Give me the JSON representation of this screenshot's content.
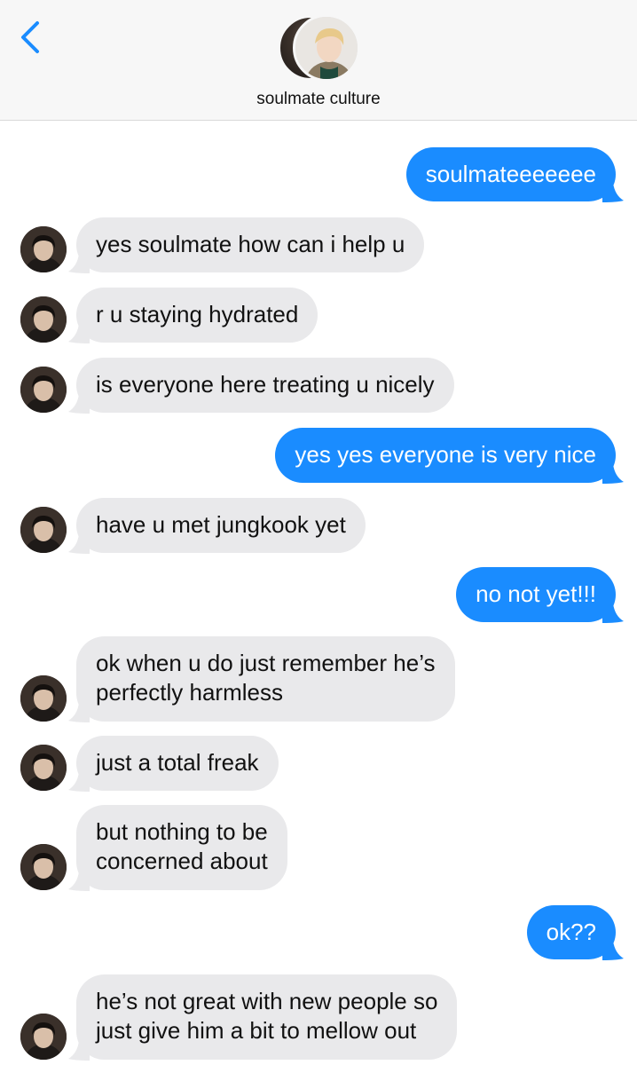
{
  "header": {
    "back_icon": "chevron-left-icon",
    "contact_name": "soulmate culture",
    "accent": "#1a8cff"
  },
  "messages": [
    {
      "dir": "out",
      "lines": [
        "soulmateeeeeee"
      ]
    },
    {
      "dir": "in",
      "lines": [
        "yes soulmate how can i help u"
      ]
    },
    {
      "dir": "in",
      "lines": [
        "r u staying hydrated"
      ]
    },
    {
      "dir": "in",
      "lines": [
        "is everyone here treating u nicely"
      ]
    },
    {
      "dir": "out",
      "lines": [
        "yes yes everyone is very nice"
      ]
    },
    {
      "dir": "in",
      "lines": [
        "have u met jungkook yet"
      ]
    },
    {
      "dir": "out",
      "lines": [
        "no not yet!!!"
      ]
    },
    {
      "dir": "in",
      "lines": [
        "ok when u do just remember he’s",
        "perfectly harmless"
      ]
    },
    {
      "dir": "in",
      "lines": [
        "just a total freak"
      ]
    },
    {
      "dir": "in",
      "lines": [
        "but nothing to be",
        "concerned about"
      ]
    },
    {
      "dir": "out",
      "lines": [
        "ok??"
      ]
    },
    {
      "dir": "in",
      "lines": [
        "he’s not great with new people so",
        "just give him a bit to mellow out"
      ]
    }
  ]
}
